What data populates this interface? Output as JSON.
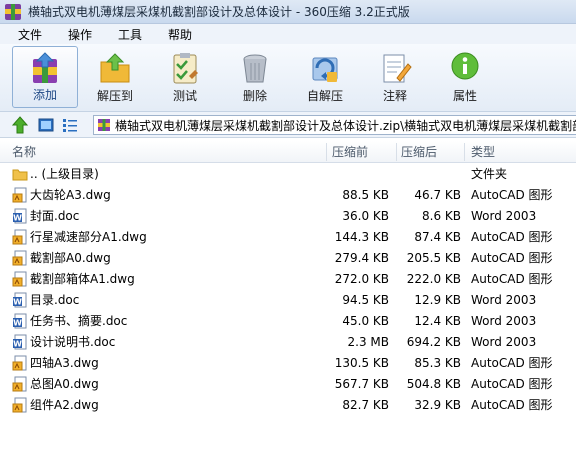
{
  "window": {
    "title": "横轴式双电机薄煤层采煤机截割部设计及总体设计 - 360压缩 3.2正式版"
  },
  "menu": [
    "文件",
    "操作",
    "工具",
    "帮助"
  ],
  "toolbar": {
    "add": "添加",
    "extract": "解压到",
    "test": "测试",
    "delete": "删除",
    "sfx": "自解压",
    "comment": "注释",
    "properties": "属性"
  },
  "address": {
    "path": "横轴式双电机薄煤层采煤机截割部设计及总体设计.zip\\横轴式双电机薄煤层采煤机截割部"
  },
  "columns": {
    "name": "名称",
    "size": "压缩前",
    "packed": "压缩后",
    "type": "类型"
  },
  "files": [
    {
      "name": ".. (上级目录)",
      "size": "",
      "packed": "",
      "type": "文件夹",
      "icon": "folder-icon"
    },
    {
      "name": "大齿轮A3.dwg",
      "size": "88.5 KB",
      "packed": "46.7 KB",
      "type": "AutoCAD 图形",
      "icon": "dwg-file-icon"
    },
    {
      "name": "封面.doc",
      "size": "36.0 KB",
      "packed": "8.6 KB",
      "type": "Word 2003",
      "icon": "doc-file-icon"
    },
    {
      "name": "行星减速部分A1.dwg",
      "size": "144.3 KB",
      "packed": "87.4 KB",
      "type": "AutoCAD 图形",
      "icon": "dwg-file-icon"
    },
    {
      "name": "截割部A0.dwg",
      "size": "279.4 KB",
      "packed": "205.5 KB",
      "type": "AutoCAD 图形",
      "icon": "dwg-file-icon"
    },
    {
      "name": "截割部箱体A1.dwg",
      "size": "272.0 KB",
      "packed": "222.0 KB",
      "type": "AutoCAD 图形",
      "icon": "dwg-file-icon"
    },
    {
      "name": "目录.doc",
      "size": "94.5 KB",
      "packed": "12.9 KB",
      "type": "Word 2003",
      "icon": "doc-file-icon"
    },
    {
      "name": "任务书、摘要.doc",
      "size": "45.0 KB",
      "packed": "12.4 KB",
      "type": "Word 2003",
      "icon": "doc-file-icon"
    },
    {
      "name": "设计说明书.doc",
      "size": "2.3 MB",
      "packed": "694.2 KB",
      "type": "Word 2003",
      "icon": "doc-file-icon"
    },
    {
      "name": "四轴A3.dwg",
      "size": "130.5 KB",
      "packed": "85.3 KB",
      "type": "AutoCAD 图形",
      "icon": "dwg-file-icon"
    },
    {
      "name": "总图A0.dwg",
      "size": "567.7 KB",
      "packed": "504.8 KB",
      "type": "AutoCAD 图形",
      "icon": "dwg-file-icon"
    },
    {
      "name": "组件A2.dwg",
      "size": "82.7 KB",
      "packed": "32.9 KB",
      "type": "AutoCAD 图形",
      "icon": "dwg-file-icon"
    }
  ]
}
